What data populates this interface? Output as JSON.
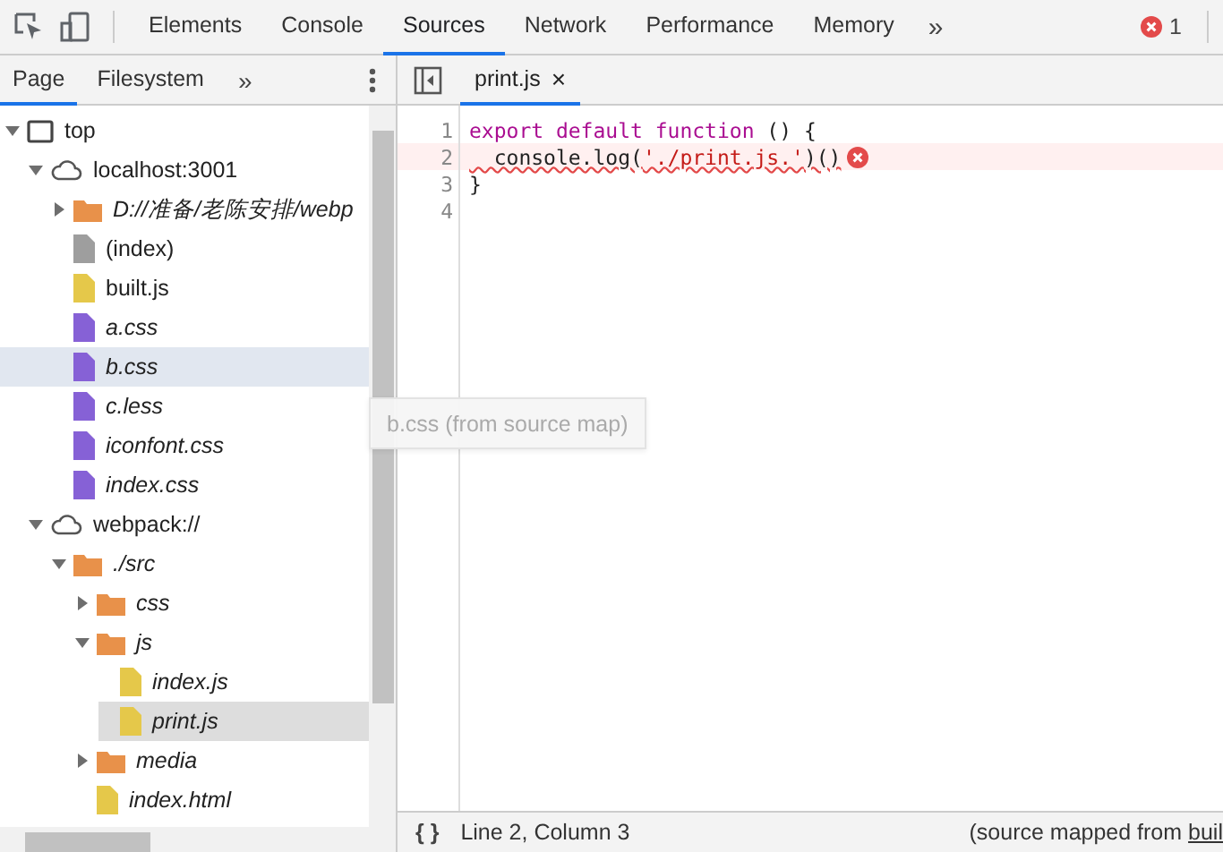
{
  "toolbar": {
    "tabs": [
      {
        "label": "Elements",
        "selected": false
      },
      {
        "label": "Console",
        "selected": false
      },
      {
        "label": "Sources",
        "selected": true
      },
      {
        "label": "Network",
        "selected": false
      },
      {
        "label": "Performance",
        "selected": false
      },
      {
        "label": "Memory",
        "selected": false
      }
    ],
    "more": "»",
    "error_count": "1"
  },
  "navigator": {
    "tabs": [
      {
        "label": "Page",
        "selected": true
      },
      {
        "label": "Filesystem",
        "selected": false
      }
    ],
    "more": "»",
    "tree": [
      {
        "label": "top",
        "kind": "frame",
        "expanded": true,
        "children": [
          {
            "label": "localhost:3001",
            "kind": "origin",
            "expanded": true,
            "children": [
              {
                "label": "D://准备/老陈安排/webp",
                "kind": "folder",
                "expanded": false,
                "mapped": true
              },
              {
                "label": "(index)",
                "kind": "file",
                "color": "#9e9e9e",
                "mapped": false
              },
              {
                "label": "built.js",
                "kind": "file",
                "color": "#e5c84a",
                "mapped": false
              },
              {
                "label": "a.css",
                "kind": "file",
                "color": "#8661d6",
                "mapped": true
              },
              {
                "label": "b.css",
                "kind": "file",
                "color": "#8661d6",
                "mapped": true,
                "hovered": true
              },
              {
                "label": "c.less",
                "kind": "file",
                "color": "#8661d6",
                "mapped": true
              },
              {
                "label": "iconfont.css",
                "kind": "file",
                "color": "#8661d6",
                "mapped": true
              },
              {
                "label": "index.css",
                "kind": "file",
                "color": "#8661d6",
                "mapped": true
              }
            ]
          },
          {
            "label": "webpack://",
            "kind": "origin",
            "expanded": true,
            "children": [
              {
                "label": "./src",
                "kind": "folder",
                "expanded": true,
                "mapped": true,
                "children": [
                  {
                    "label": "css",
                    "kind": "folder",
                    "expanded": false,
                    "mapped": true
                  },
                  {
                    "label": "js",
                    "kind": "folder",
                    "expanded": true,
                    "mapped": true,
                    "children": [
                      {
                        "label": "index.js",
                        "kind": "file",
                        "color": "#e5c84a",
                        "mapped": true
                      },
                      {
                        "label": "print.js",
                        "kind": "file",
                        "color": "#e5c84a",
                        "mapped": true,
                        "selected": true
                      }
                    ]
                  },
                  {
                    "label": "media",
                    "kind": "folder",
                    "expanded": false,
                    "mapped": true
                  },
                  {
                    "label": "index.html",
                    "kind": "file",
                    "color": "#e5c84a",
                    "mapped": true
                  }
                ]
              }
            ]
          }
        ]
      }
    ]
  },
  "editor": {
    "tabs": [
      {
        "label": "print.js",
        "close": "×",
        "selected": true
      }
    ],
    "lines": [
      {
        "number": "1",
        "error": false,
        "segments": [
          {
            "text": "export default function",
            "kind": "keyword"
          },
          {
            "text": " () {",
            "kind": "plain"
          }
        ]
      },
      {
        "number": "2",
        "error": true,
        "segments": [
          {
            "text": "  console.log(",
            "kind": "plain"
          },
          {
            "text": "'./print.js.'",
            "kind": "string"
          },
          {
            "text": ")()",
            "kind": "plain"
          }
        ]
      },
      {
        "number": "3",
        "error": false,
        "segments": [
          {
            "text": "}",
            "kind": "plain"
          }
        ]
      },
      {
        "number": "4",
        "error": false
      }
    ]
  },
  "tooltip": "b.css (from source map)",
  "status_bar": {
    "format": "{ }",
    "position": "Line 2, Column 3",
    "source_prefix": "(source mapped from ",
    "source_link": "buil"
  }
}
